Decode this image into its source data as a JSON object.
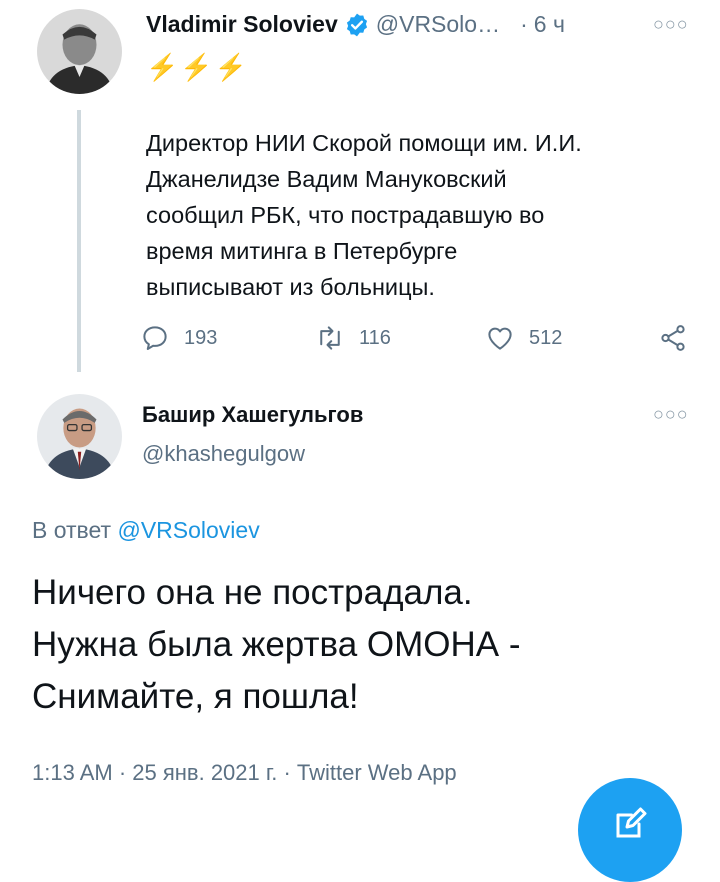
{
  "tweet1": {
    "name": "Vladimir Soloviev",
    "handle": "@VRSolo…",
    "separator": "·",
    "time": "6 ч",
    "emojis": "⚡⚡⚡",
    "text_lines": [
      "Директор НИИ Скорой помощи им. И.И.",
      "Джанелидзе Вадим Мануковский",
      "сообщил РБК, что пострадавшую во",
      "время митинга в Петербурге",
      "выписывают из больницы."
    ],
    "replies": "193",
    "retweets": "116",
    "likes": "512"
  },
  "tweet2": {
    "name": "Башир Хашегульгов",
    "handle": "@khashegulgow",
    "reply_prefix": "В ответ",
    "reply_to": "@VRSoloviev",
    "text_lines": [
      "Ничего она не пострадала.",
      "Нужна была жертва ОМОНА -",
      "Снимайте, я пошла!"
    ],
    "meta": "1:13 AM · 25 янв. 2021 г. · Twitter Web App"
  },
  "colors": {
    "accent": "#1da1f2",
    "link": "#1b95e0",
    "secondary_text": "#5b7083",
    "verified": "#1da1f2",
    "emoji": "#f4a51c"
  },
  "icons": {
    "verified": "verified-badge-icon",
    "reply": "reply-icon",
    "retweet": "retweet-icon",
    "like": "heart-icon",
    "share": "share-icon",
    "more": "more-icon",
    "compose": "compose-icon"
  }
}
